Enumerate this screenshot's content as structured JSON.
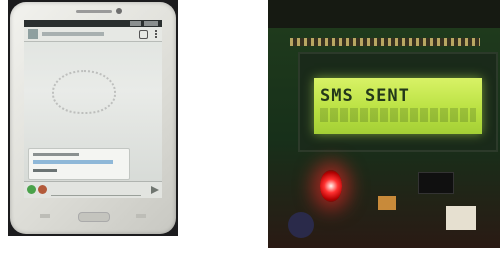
{
  "phone": {
    "text_legibility": "illegible",
    "bubble_color": "#f4f5f2",
    "screen_background": "#e3e6e2"
  },
  "lcd": {
    "row1": "SMS SENT",
    "backlight_color": "#c8ea50",
    "text_color": "#23381a"
  },
  "led": {
    "state": "on",
    "color": "#ff3030"
  }
}
